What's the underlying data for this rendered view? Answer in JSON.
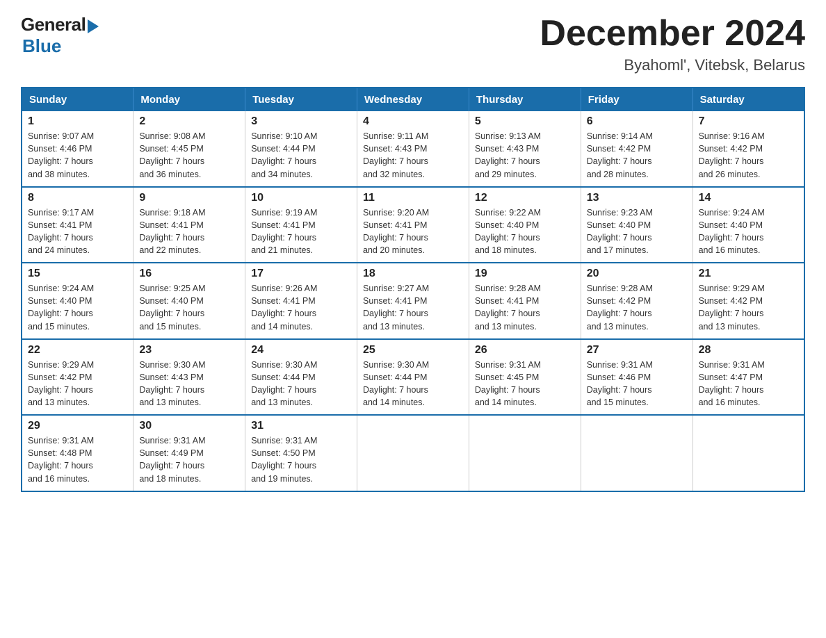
{
  "logo": {
    "general": "General",
    "blue": "Blue"
  },
  "title": "December 2024",
  "subtitle": "Byahoml', Vitebsk, Belarus",
  "days_of_week": [
    "Sunday",
    "Monday",
    "Tuesday",
    "Wednesday",
    "Thursday",
    "Friday",
    "Saturday"
  ],
  "weeks": [
    [
      {
        "day": "1",
        "sunrise": "Sunrise: 9:07 AM",
        "sunset": "Sunset: 4:46 PM",
        "daylight": "Daylight: 7 hours",
        "daylight2": "and 38 minutes."
      },
      {
        "day": "2",
        "sunrise": "Sunrise: 9:08 AM",
        "sunset": "Sunset: 4:45 PM",
        "daylight": "Daylight: 7 hours",
        "daylight2": "and 36 minutes."
      },
      {
        "day": "3",
        "sunrise": "Sunrise: 9:10 AM",
        "sunset": "Sunset: 4:44 PM",
        "daylight": "Daylight: 7 hours",
        "daylight2": "and 34 minutes."
      },
      {
        "day": "4",
        "sunrise": "Sunrise: 9:11 AM",
        "sunset": "Sunset: 4:43 PM",
        "daylight": "Daylight: 7 hours",
        "daylight2": "and 32 minutes."
      },
      {
        "day": "5",
        "sunrise": "Sunrise: 9:13 AM",
        "sunset": "Sunset: 4:43 PM",
        "daylight": "Daylight: 7 hours",
        "daylight2": "and 29 minutes."
      },
      {
        "day": "6",
        "sunrise": "Sunrise: 9:14 AM",
        "sunset": "Sunset: 4:42 PM",
        "daylight": "Daylight: 7 hours",
        "daylight2": "and 28 minutes."
      },
      {
        "day": "7",
        "sunrise": "Sunrise: 9:16 AM",
        "sunset": "Sunset: 4:42 PM",
        "daylight": "Daylight: 7 hours",
        "daylight2": "and 26 minutes."
      }
    ],
    [
      {
        "day": "8",
        "sunrise": "Sunrise: 9:17 AM",
        "sunset": "Sunset: 4:41 PM",
        "daylight": "Daylight: 7 hours",
        "daylight2": "and 24 minutes."
      },
      {
        "day": "9",
        "sunrise": "Sunrise: 9:18 AM",
        "sunset": "Sunset: 4:41 PM",
        "daylight": "Daylight: 7 hours",
        "daylight2": "and 22 minutes."
      },
      {
        "day": "10",
        "sunrise": "Sunrise: 9:19 AM",
        "sunset": "Sunset: 4:41 PM",
        "daylight": "Daylight: 7 hours",
        "daylight2": "and 21 minutes."
      },
      {
        "day": "11",
        "sunrise": "Sunrise: 9:20 AM",
        "sunset": "Sunset: 4:41 PM",
        "daylight": "Daylight: 7 hours",
        "daylight2": "and 20 minutes."
      },
      {
        "day": "12",
        "sunrise": "Sunrise: 9:22 AM",
        "sunset": "Sunset: 4:40 PM",
        "daylight": "Daylight: 7 hours",
        "daylight2": "and 18 minutes."
      },
      {
        "day": "13",
        "sunrise": "Sunrise: 9:23 AM",
        "sunset": "Sunset: 4:40 PM",
        "daylight": "Daylight: 7 hours",
        "daylight2": "and 17 minutes."
      },
      {
        "day": "14",
        "sunrise": "Sunrise: 9:24 AM",
        "sunset": "Sunset: 4:40 PM",
        "daylight": "Daylight: 7 hours",
        "daylight2": "and 16 minutes."
      }
    ],
    [
      {
        "day": "15",
        "sunrise": "Sunrise: 9:24 AM",
        "sunset": "Sunset: 4:40 PM",
        "daylight": "Daylight: 7 hours",
        "daylight2": "and 15 minutes."
      },
      {
        "day": "16",
        "sunrise": "Sunrise: 9:25 AM",
        "sunset": "Sunset: 4:40 PM",
        "daylight": "Daylight: 7 hours",
        "daylight2": "and 15 minutes."
      },
      {
        "day": "17",
        "sunrise": "Sunrise: 9:26 AM",
        "sunset": "Sunset: 4:41 PM",
        "daylight": "Daylight: 7 hours",
        "daylight2": "and 14 minutes."
      },
      {
        "day": "18",
        "sunrise": "Sunrise: 9:27 AM",
        "sunset": "Sunset: 4:41 PM",
        "daylight": "Daylight: 7 hours",
        "daylight2": "and 13 minutes."
      },
      {
        "day": "19",
        "sunrise": "Sunrise: 9:28 AM",
        "sunset": "Sunset: 4:41 PM",
        "daylight": "Daylight: 7 hours",
        "daylight2": "and 13 minutes."
      },
      {
        "day": "20",
        "sunrise": "Sunrise: 9:28 AM",
        "sunset": "Sunset: 4:42 PM",
        "daylight": "Daylight: 7 hours",
        "daylight2": "and 13 minutes."
      },
      {
        "day": "21",
        "sunrise": "Sunrise: 9:29 AM",
        "sunset": "Sunset: 4:42 PM",
        "daylight": "Daylight: 7 hours",
        "daylight2": "and 13 minutes."
      }
    ],
    [
      {
        "day": "22",
        "sunrise": "Sunrise: 9:29 AM",
        "sunset": "Sunset: 4:42 PM",
        "daylight": "Daylight: 7 hours",
        "daylight2": "and 13 minutes."
      },
      {
        "day": "23",
        "sunrise": "Sunrise: 9:30 AM",
        "sunset": "Sunset: 4:43 PM",
        "daylight": "Daylight: 7 hours",
        "daylight2": "and 13 minutes."
      },
      {
        "day": "24",
        "sunrise": "Sunrise: 9:30 AM",
        "sunset": "Sunset: 4:44 PM",
        "daylight": "Daylight: 7 hours",
        "daylight2": "and 13 minutes."
      },
      {
        "day": "25",
        "sunrise": "Sunrise: 9:30 AM",
        "sunset": "Sunset: 4:44 PM",
        "daylight": "Daylight: 7 hours",
        "daylight2": "and 14 minutes."
      },
      {
        "day": "26",
        "sunrise": "Sunrise: 9:31 AM",
        "sunset": "Sunset: 4:45 PM",
        "daylight": "Daylight: 7 hours",
        "daylight2": "and 14 minutes."
      },
      {
        "day": "27",
        "sunrise": "Sunrise: 9:31 AM",
        "sunset": "Sunset: 4:46 PM",
        "daylight": "Daylight: 7 hours",
        "daylight2": "and 15 minutes."
      },
      {
        "day": "28",
        "sunrise": "Sunrise: 9:31 AM",
        "sunset": "Sunset: 4:47 PM",
        "daylight": "Daylight: 7 hours",
        "daylight2": "and 16 minutes."
      }
    ],
    [
      {
        "day": "29",
        "sunrise": "Sunrise: 9:31 AM",
        "sunset": "Sunset: 4:48 PM",
        "daylight": "Daylight: 7 hours",
        "daylight2": "and 16 minutes."
      },
      {
        "day": "30",
        "sunrise": "Sunrise: 9:31 AM",
        "sunset": "Sunset: 4:49 PM",
        "daylight": "Daylight: 7 hours",
        "daylight2": "and 18 minutes."
      },
      {
        "day": "31",
        "sunrise": "Sunrise: 9:31 AM",
        "sunset": "Sunset: 4:50 PM",
        "daylight": "Daylight: 7 hours",
        "daylight2": "and 19 minutes."
      },
      null,
      null,
      null,
      null
    ]
  ]
}
